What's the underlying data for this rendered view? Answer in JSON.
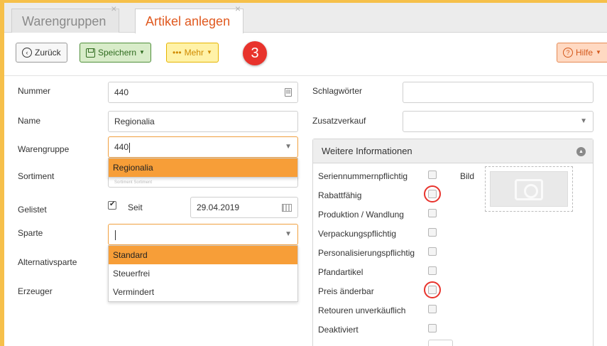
{
  "tabs": [
    {
      "label": "Warengruppen",
      "close": "×"
    },
    {
      "label": "Artikel anlegen",
      "close": "×"
    }
  ],
  "toolbar": {
    "back_label": "Zurück",
    "save_label": "Speichern",
    "more_label": "Mehr",
    "help_label": "Hilfe",
    "step_badge": "3",
    "dots": "•••"
  },
  "form": {
    "nummer_label": "Nummer",
    "nummer_value": "440",
    "name_label": "Name",
    "name_value": "Regionalia",
    "warengruppe_label": "Warengruppe",
    "warengruppe_value": "440",
    "warengruppe_options": [
      "Regionalia"
    ],
    "sortiment_label": "Sortiment",
    "sortiment_value": "Sortiment Sortiment",
    "gelistet_label": "Gelistet",
    "gelistet_checked": true,
    "seit_label": "Seit",
    "seit_value": "29.04.2019",
    "sparte_label": "Sparte",
    "sparte_value": "",
    "sparte_options": [
      "Standard",
      "Steuerfrei",
      "Vermindert"
    ],
    "alternativsparte_label": "Alternativsparte",
    "erzeuger_label": "Erzeuger",
    "schlagwoerter_label": "Schlagwörter",
    "zusatzverkauf_label": "Zusatzverkauf"
  },
  "panel": {
    "title": "Weitere Informationen",
    "bild_label": "Bild",
    "checks": [
      {
        "label": "Seriennummernpflichtig",
        "checked": false
      },
      {
        "label": "Rabattfähig",
        "checked": false
      },
      {
        "label": "Produktion / Wandlung",
        "checked": false
      },
      {
        "label": "Verpackungspflichtig",
        "checked": false
      },
      {
        "label": "Personalisierungspflichtig",
        "checked": false
      },
      {
        "label": "Pfandartikel",
        "checked": false
      },
      {
        "label": "Preis änderbar",
        "checked": false
      },
      {
        "label": "Retouren unverkäuflich",
        "checked": false
      },
      {
        "label": "Deaktiviert",
        "checked": false
      }
    ]
  },
  "colors": {
    "accent_orange": "#e0591f",
    "frame_yellow": "#f6c04a",
    "highlight": "#f79e38",
    "annotation_red": "#e8332c"
  }
}
